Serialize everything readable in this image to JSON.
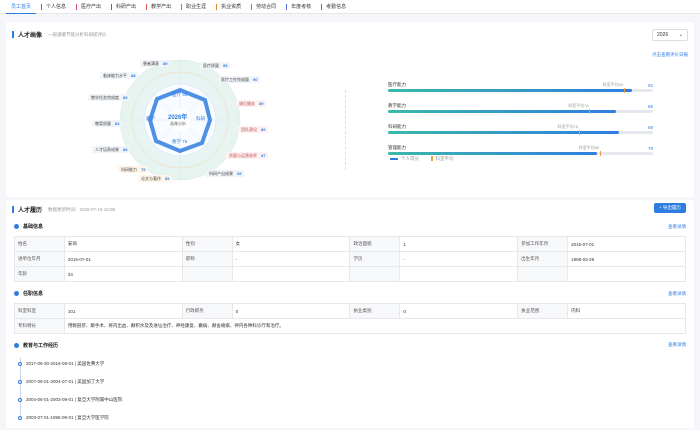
{
  "nav": {
    "tabs": [
      {
        "label": "员工首页",
        "color": "#2f7de1"
      },
      {
        "label": "个人信息",
        "color": "#2f7de1"
      },
      {
        "label": "医疗产出",
        "color": "#d64a8a"
      },
      {
        "label": "科研产出",
        "color": "#7a4bd6"
      },
      {
        "label": "教学产出",
        "color": "#e05252"
      },
      {
        "label": "职业生涯",
        "color": "#3aa0d8"
      },
      {
        "label": "执业资质",
        "color": "#e08a2a"
      },
      {
        "label": "劳动合同",
        "color": "#3bb36a"
      },
      {
        "label": "年度考核",
        "color": "#5a6bd6"
      },
      {
        "label": "考勤信息",
        "color": "#c03aa0"
      }
    ]
  },
  "portrait": {
    "title": "人才画像",
    "subtitle": "一般遵循节能分析科研提评价",
    "year": "2026",
    "report_link": "点击查看评价日报",
    "center_year": "2026年",
    "center_label": "画像分析",
    "inner": {
      "top": "医疗 93",
      "left": "教学",
      "right": "科研",
      "bottom": "教学 76"
    },
    "tags": [
      {
        "label": "患者满意",
        "value": "89"
      },
      {
        "label": "医疗质量",
        "value": "95"
      },
      {
        "label": "临床能力水平",
        "value": "88"
      },
      {
        "label": "医疗工作完成量",
        "value": "90"
      },
      {
        "label": "教学任务完成度",
        "value": "85"
      },
      {
        "label": "课后服务",
        "value": "89"
      },
      {
        "label": "教案质量",
        "value": "84"
      },
      {
        "label": "团队建设",
        "value": "89"
      },
      {
        "label": "人才培养成果",
        "value": "88"
      },
      {
        "label": "质量与运营效率",
        "value": "87"
      },
      {
        "label": "科研能力",
        "value": "75"
      },
      {
        "label": "科研产出成果",
        "value": "69"
      },
      {
        "label": "论文与著作",
        "value": "85"
      }
    ],
    "abilities": [
      {
        "name": "医疗能力",
        "std": "科室平均94",
        "value": "92",
        "pct": 92,
        "stdpct": 89
      },
      {
        "name": "教学能力",
        "std": "科室平均76",
        "value": "86",
        "pct": 86,
        "stdpct": 76
      },
      {
        "name": "科研能力",
        "std": "科室平均78",
        "value": "69",
        "pct": 87,
        "stdpct": 72
      },
      {
        "name": "管理能力",
        "std": "科室平均80",
        "value": "79",
        "pct": 79,
        "stdpct": 80
      }
    ],
    "legend": {
      "a": "个人得分",
      "b": "科室平均"
    }
  },
  "resume": {
    "title": "人才履历",
    "updated": "数据更新时间：2026-07-19 16:08",
    "export": "+ 导出履历",
    "basic_title": "基础信息",
    "view_more": "查看详情",
    "basic": [
      [
        "姓名",
        "安琦",
        "性别",
        "女",
        "政治面貌",
        "1",
        "参加工作年月",
        "2015-07-01"
      ],
      [
        "进单位年月",
        "2015-07-01",
        "职称",
        "-",
        "学历",
        "-",
        "出生年月",
        "1998-03-29"
      ],
      [
        "年龄",
        "34",
        "",
        "",
        "",
        "",
        "",
        ""
      ]
    ],
    "post_title": "任职信息",
    "post": [
      [
        "科室科室",
        "101",
        "行政职务",
        "0",
        "执业类别",
        "0",
        "执业范围",
        "内科"
      ]
    ],
    "skill_label": "专科特长",
    "skill_value": "用颗剖挤、颠手术、将内出血、颠积水及及进址治疗、神经康复、癫痫、颠舍瘫痪、神内各种科诊疗和治疗。",
    "edu_title": "教育与工作经历",
    "edu": [
      "2017-06-30-2016-09-01 | 美国佐弗大学",
      "2007-09-01-2004-07-01 | 美国加丁大学",
      "2004-06-01-2003-09-01 | 复旦大学附属中山医院",
      "2003-07-01-1996-09-01 | 复旦大学医学院"
    ]
  }
}
